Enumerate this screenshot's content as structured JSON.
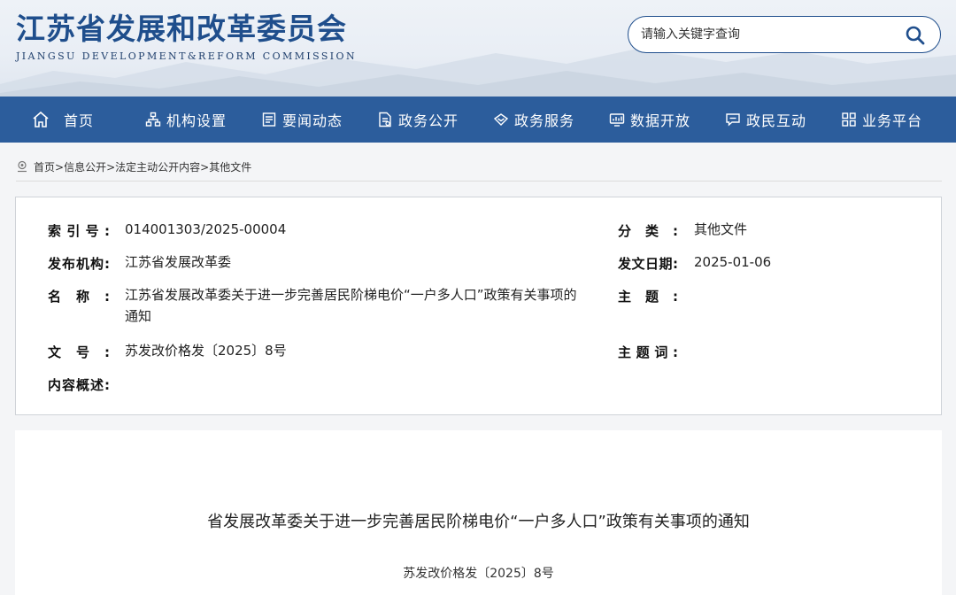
{
  "header": {
    "title": "江苏省发展和改革委员会",
    "subtitle": "JIANGSU DEVELOPMENT&REFORM COMMISSION",
    "search_placeholder": "请输入关键字查询"
  },
  "nav": {
    "items": [
      {
        "label": "首页",
        "icon": "home-icon"
      },
      {
        "label": "机构设置",
        "icon": "org-chart-icon"
      },
      {
        "label": "要闻动态",
        "icon": "news-icon"
      },
      {
        "label": "政务公开",
        "icon": "document-icon"
      },
      {
        "label": "政务服务",
        "icon": "service-icon"
      },
      {
        "label": "数据开放",
        "icon": "data-icon"
      },
      {
        "label": "政民互动",
        "icon": "chat-icon"
      },
      {
        "label": "业务平台",
        "icon": "grid-icon"
      }
    ]
  },
  "breadcrumb": {
    "items": [
      "首页>",
      "信息公开>",
      "法定主动公开内容>",
      "其他文件"
    ]
  },
  "info": {
    "index_label": "索引号:",
    "index_value": "014001303/2025-00004",
    "category_label": "分类:",
    "category_value": "其他文件",
    "publisher_label": "发布机构:",
    "publisher_value": "江苏省发展改革委",
    "date_label": "发文日期:",
    "date_value": "2025-01-06",
    "name_label": "名称:",
    "name_value": "江苏省发展改革委关于进一步完善居民阶梯电价“一户多人口”政策有关事项的通知",
    "topic_label": "主题:",
    "topic_value": "",
    "docno_label": "文号:",
    "docno_value": "苏发改价格发〔2025〕8号",
    "keywords_label": "主题词:",
    "keywords_value": "",
    "summary_label": "内容概述:",
    "summary_value": ""
  },
  "article": {
    "title": "省发展改革委关于进一步完善居民阶梯电价“一户多人口”政策有关事项的通知",
    "doc_number": "苏发改价格发〔2025〕8号"
  },
  "colors": {
    "brand": "#1f4e8c",
    "nav_bg": "#2c5d9c"
  }
}
